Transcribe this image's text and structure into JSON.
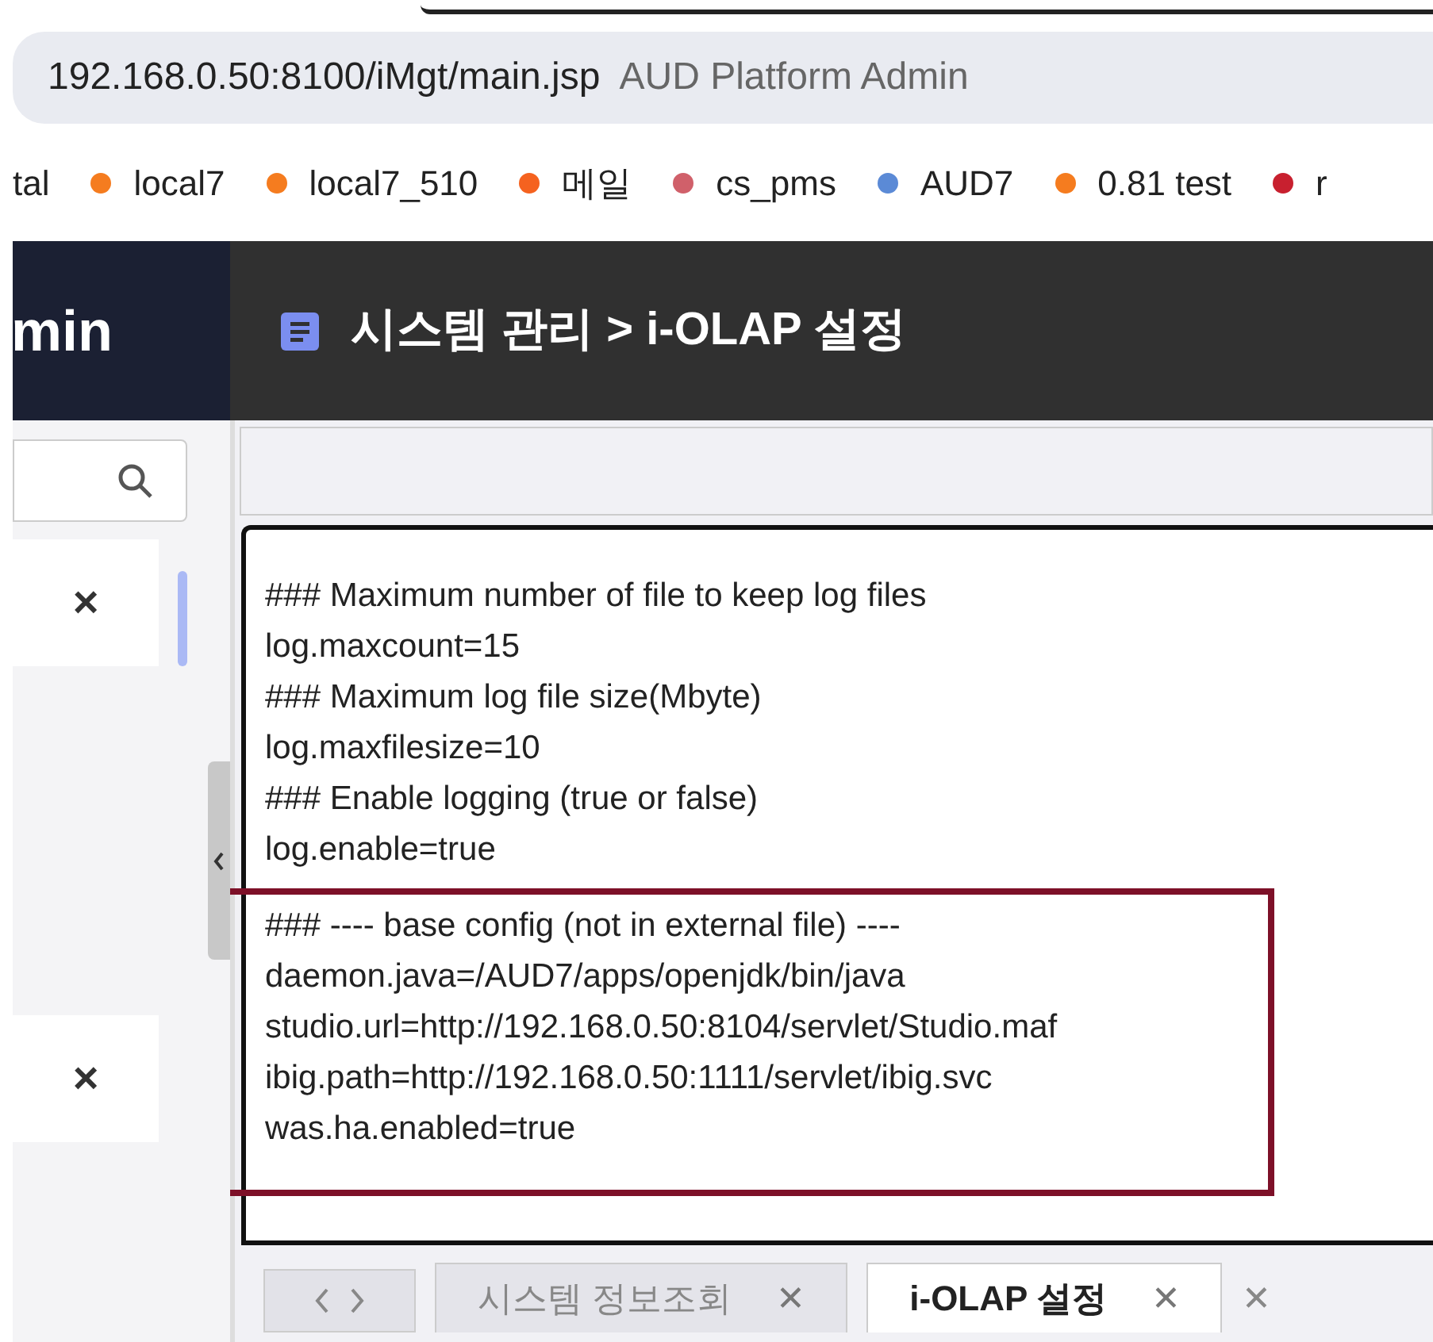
{
  "browser": {
    "url": "192.168.0.50:8100/iMgt/main.jsp",
    "page_title": "AUD Platform Admin"
  },
  "bookmarks": [
    {
      "label": "tal"
    },
    {
      "label": "local7",
      "color": "#f57c1f"
    },
    {
      "label": "local7_510",
      "color": "#f57c1f"
    },
    {
      "label": "메일",
      "color": "#f5621f"
    },
    {
      "label": "cs_pms",
      "color": "#d0606a"
    },
    {
      "label": "AUD7",
      "color": "#5b8ad6"
    },
    {
      "label": "0.81 test",
      "color": "#f57c1f"
    },
    {
      "label": "r",
      "color": "#c8202f"
    }
  ],
  "brand": "min",
  "breadcrumb": "시스템 관리 > i-OLAP 설정",
  "sidebar": {
    "rows": [
      {
        "close": "×"
      },
      {
        "close": "×"
      }
    ]
  },
  "editor": {
    "sections": [
      {
        "highlighted": false,
        "lines": [
          "### Maximum number of file to keep log files",
          "log.maxcount=15",
          "### Maximum log file size(Mbyte)",
          "log.maxfilesize=10",
          "### Enable logging (true or false)",
          "log.enable=true"
        ]
      },
      {
        "highlighted": true,
        "lines": [
          "### ---- base config (not in external file) ----",
          "daemon.java=/AUD7/apps/openjdk/bin/java",
          "studio.url=http://192.168.0.50:8104/servlet/Studio.maf",
          "ibig.path=http://192.168.0.50:1111/servlet/ibig.svc",
          "was.ha.enabled=true"
        ]
      }
    ]
  },
  "tabs": [
    {
      "label": "시스템 정보조회",
      "selected": false,
      "close": "✕"
    },
    {
      "label": "i-OLAP 설정",
      "selected": true,
      "close": "✕"
    }
  ],
  "close_all": "✕"
}
